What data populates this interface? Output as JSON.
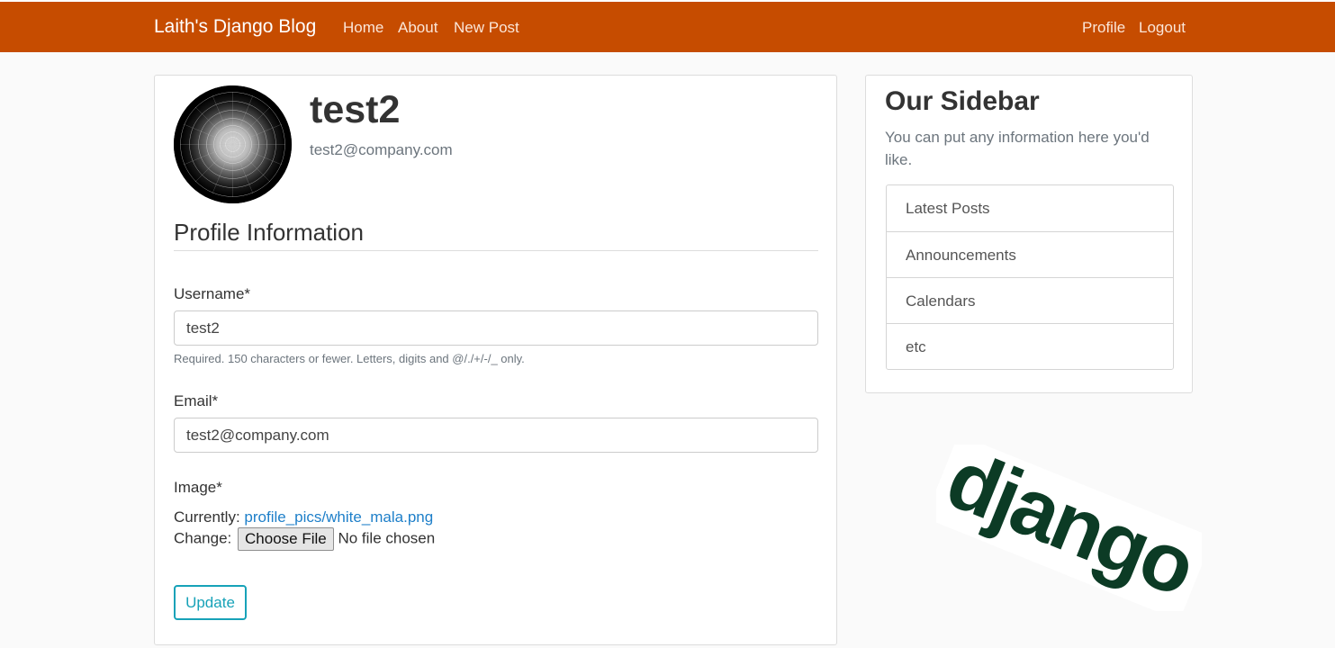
{
  "navbar": {
    "brand": "Laith's Django Blog",
    "links": [
      "Home",
      "About",
      "New Post"
    ],
    "right_links": [
      "Profile",
      "Logout"
    ],
    "color": "#c64c00"
  },
  "profile": {
    "username": "test2",
    "email": "test2@company.com"
  },
  "form": {
    "legend": "Profile Information",
    "username_label": "Username*",
    "username_value": "test2",
    "username_help": "Required. 150 characters or fewer. Letters, digits and @/./+/-/_ only.",
    "email_label": "Email*",
    "email_value": "test2@company.com",
    "image_label": "Image*",
    "currently_label": "Currently:",
    "current_file": "profile_pics/white_mala.png",
    "change_label": "Change:",
    "choose_file_button": "Choose File",
    "no_file_text": "No file chosen",
    "submit_label": "Update"
  },
  "sidebar": {
    "title": "Our Sidebar",
    "description": "You can put any information here you'd like.",
    "items": [
      "Latest Posts",
      "Announcements",
      "Calendars",
      "etc"
    ]
  },
  "logo": {
    "text": "django",
    "color": "#0c3b25"
  }
}
